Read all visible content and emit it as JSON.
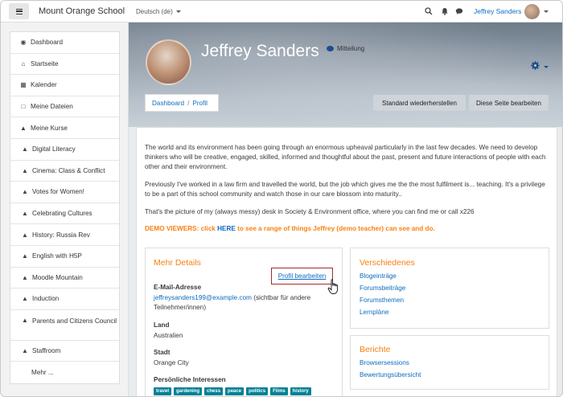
{
  "navbar": {
    "site_name": "Mount Orange School",
    "language": "Deutsch (de)",
    "user_name": "Jeffrey Sanders"
  },
  "sidebar": {
    "items": [
      {
        "label": "Dashboard",
        "icon": "dashboard-icon"
      },
      {
        "label": "Startseite",
        "icon": "home-icon"
      },
      {
        "label": "Kalender",
        "icon": "calendar-icon"
      },
      {
        "label": "Meine Dateien",
        "icon": "file-icon"
      },
      {
        "label": "Meine Kurse",
        "icon": "graduation-cap-icon"
      },
      {
        "label": "Digital Literacy",
        "icon": "graduation-cap-icon"
      },
      {
        "label": "Cinema: Class & Conflict",
        "icon": "graduation-cap-icon"
      },
      {
        "label": "Votes for Women!",
        "icon": "graduation-cap-icon"
      },
      {
        "label": "Celebrating Cultures",
        "icon": "graduation-cap-icon"
      },
      {
        "label": "History: Russia Rev",
        "icon": "graduation-cap-icon"
      },
      {
        "label": "English with H5P",
        "icon": "graduation-cap-icon"
      },
      {
        "label": "Moodle Mountain",
        "icon": "graduation-cap-icon"
      },
      {
        "label": "Induction",
        "icon": "graduation-cap-icon"
      },
      {
        "label": "Parents and Citizens Council",
        "icon": "graduation-cap-icon"
      },
      {
        "label": "Staffroom",
        "icon": "graduation-cap-icon"
      }
    ],
    "more_label": "Mehr ..."
  },
  "header": {
    "name": "Jeffrey Sanders",
    "message_label": "Mitteilung",
    "breadcrumb": [
      "Dashboard",
      "Profil"
    ],
    "reset_button": "Standard wiederherstellen",
    "edit_page_button": "Diese Seite bearbeiten"
  },
  "intro": {
    "p1": "The world and its environment has been going through an enormous upheaval particularly in the last few decades. We need to develop thinkers who will be creative, engaged, skilled, informed and thoughtful about the past, present and future interactions of people with each other and their environment.",
    "p2": "Previously I've worked in a law firm and travelled the world,  but the job which gives me the the most fulfilment is... teaching. It's a privilege to be a part of this school community and watch those in our care blossom into maturity..",
    "p3": "That's the picture of my (always messy) desk in Society & Environment office, where you can find me or call x226",
    "demo_prefix": "DEMO VIEWERS: click ",
    "demo_here": "HERE",
    "demo_suffix": " to see a range of things Jeffrey (demo teacher) can see and do."
  },
  "details": {
    "title": "Mehr Details",
    "edit_link": "Profil bearbeiten",
    "email_label": "E-Mail-Adresse",
    "email_value": "jeffreysanders199@example.com",
    "email_note": " (sichtbar für andere Teilnehmer/innen)",
    "country_label": "Land",
    "country_value": "Australien",
    "city_label": "Stadt",
    "city_value": "Orange City",
    "interests_label": "Persönliche Interessen",
    "interests": [
      "travel",
      "gardening",
      "chess",
      "peace",
      "politics",
      "Films",
      "history"
    ]
  },
  "misc": {
    "title": "Verschiedenes",
    "links": [
      "Blogeinträge",
      "Forumsbeiträge",
      "Forumsthemen",
      "Lernpläne"
    ]
  },
  "reports": {
    "title": "Berichte",
    "links": [
      "Browsersessions",
      "Bewertungsübersicht"
    ]
  },
  "colors": {
    "accent_orange": "#f98012",
    "link_blue": "#0f6cbf",
    "tag_teal": "#008196"
  }
}
